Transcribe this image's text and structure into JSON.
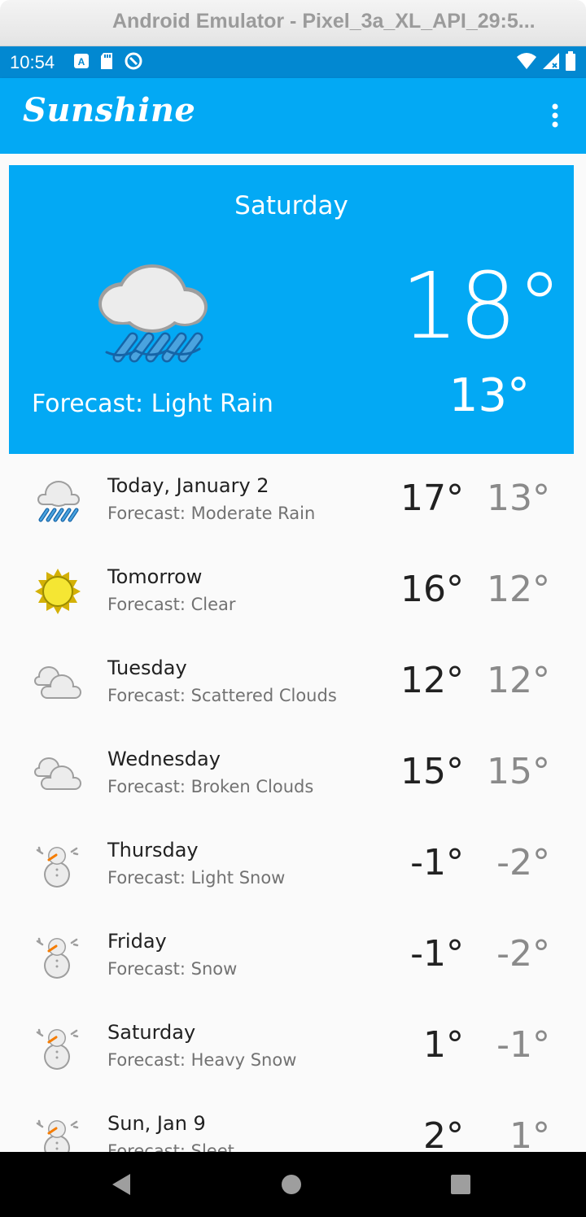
{
  "emulator": {
    "title": "Android Emulator - Pixel_3a_XL_API_29:5..."
  },
  "status_bar": {
    "time": "10:54",
    "left_icons": [
      "a-notification-icon",
      "sd-card-icon",
      "data-saver-icon"
    ],
    "right_icons": [
      "wifi-icon",
      "signal-icon",
      "battery-icon"
    ]
  },
  "app_bar": {
    "title": "Sunshine",
    "menu_icon": "more-vert-icon"
  },
  "today": {
    "day": "Saturday",
    "icon": "rain-icon",
    "forecast": "Forecast: Light Rain",
    "high": "18°",
    "low": "13°"
  },
  "forecast": [
    {
      "date": "Today, January 2",
      "desc": "Forecast: Moderate Rain",
      "high": "17°",
      "low": "13°",
      "icon": "rain-icon"
    },
    {
      "date": "Tomorrow",
      "desc": "Forecast: Clear",
      "high": "16°",
      "low": "12°",
      "icon": "sun-icon"
    },
    {
      "date": "Tuesday",
      "desc": "Forecast: Scattered Clouds",
      "high": "12°",
      "low": "12°",
      "icon": "clouds-icon"
    },
    {
      "date": "Wednesday",
      "desc": "Forecast: Broken Clouds",
      "high": "15°",
      "low": "15°",
      "icon": "clouds-icon"
    },
    {
      "date": "Thursday",
      "desc": "Forecast: Light Snow",
      "high": "-1°",
      "low": "-2°",
      "icon": "snowman-icon"
    },
    {
      "date": "Friday",
      "desc": "Forecast: Snow",
      "high": "-1°",
      "low": "-2°",
      "icon": "snowman-icon"
    },
    {
      "date": "Saturday",
      "desc": "Forecast: Heavy Snow",
      "high": "1°",
      "low": "-1°",
      "icon": "snowman-icon"
    },
    {
      "date": "Sun, Jan 9",
      "desc": "Forecast: Sleet",
      "high": "2°",
      "low": "1°",
      "icon": "snowman-icon"
    }
  ],
  "nav_bar": {
    "buttons": [
      "back-icon",
      "home-icon",
      "recents-icon"
    ]
  },
  "colors": {
    "primary": "#03a9f4",
    "primary_dark": "#0288d1",
    "text_primary": "#212121",
    "text_secondary": "#727272"
  }
}
